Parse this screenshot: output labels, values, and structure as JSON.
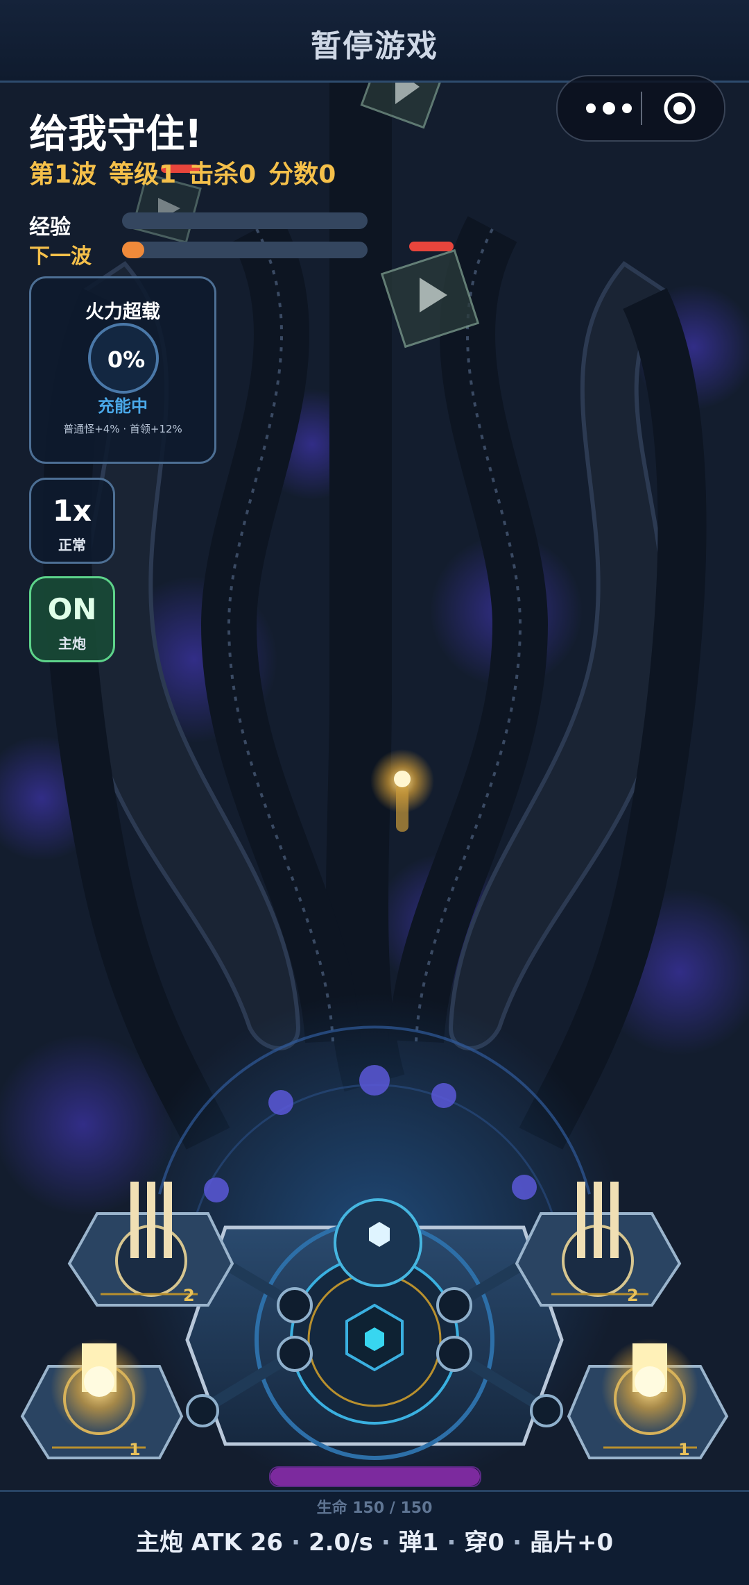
{
  "header": {
    "title": "暂停游戏"
  },
  "capsule": {
    "more_icon": "ellipsis-icon",
    "close_icon": "target-circle-icon"
  },
  "hud": {
    "mission_title": "给我守住!",
    "wave": "第1波",
    "level": "等级1",
    "kills": "击杀0",
    "score": "分数0",
    "exp_label": "经验",
    "exp_progress": 0.0,
    "next_wave_label": "下一波",
    "next_wave_progress": 0.09
  },
  "overload": {
    "title": "火力超载",
    "percent": "0%",
    "status": "充能中",
    "note": "普通怪+4% · 首领+12%"
  },
  "speed_button": {
    "value": "1x",
    "label": "正常"
  },
  "cannon_toggle": {
    "value": "ON",
    "label": "主炮"
  },
  "turret_levels": [
    "2",
    "2",
    "1",
    "1"
  ],
  "base": {
    "hp_text": "生命 150 / 150",
    "hp_fraction": 1.0
  },
  "footer": {
    "cannon_atk": "主炮 ATK 26",
    "rate": "2.0/s",
    "ammo": "弹1",
    "pierce": "穿0",
    "shards": "晶片+0"
  },
  "colors": {
    "accent_gold": "#f5c04a",
    "exp_bar": "#34465f",
    "next_wave_bar": "#f08a3a",
    "enemy_hp": "#e8453c",
    "on_green": "#5dd38a",
    "hp_purple": "#7c2a9e"
  }
}
